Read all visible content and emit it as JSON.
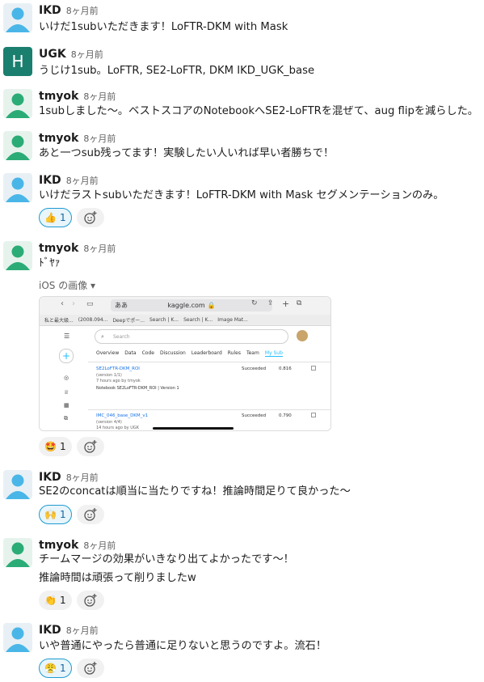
{
  "messages": [
    {
      "author": "IKD",
      "time": "8ヶ月前",
      "lines": [
        "いけだ1subいただきます！LoFTR-DKM with Mask"
      ]
    },
    {
      "author": "UGK",
      "avatar_letter": "H",
      "time": "8ヶ月前",
      "lines": [
        "うじけ1sub。LoFTR, SE2-LoFTR, DKM IKD_UGK_base"
      ]
    },
    {
      "author": "tmyok",
      "time": "8ヶ月前",
      "lines": [
        "1subしました〜。ベストスコアのNotebookへSE2-LoFTRを混ぜて、aug flipを減らした。"
      ]
    },
    {
      "author": "tmyok",
      "time": "8ヶ月前",
      "lines": [
        "あと一つsub残ってます！実験したい人いれば早い者勝ちで！"
      ]
    },
    {
      "author": "IKD",
      "time": "8ヶ月前",
      "lines": [
        "いけだラストsubいただきます！LoFTR-DKM with Mask セグメンテーションのみ。"
      ],
      "reaction": {
        "emoji": "👍",
        "count": "1"
      }
    },
    {
      "author": "tmyok",
      "time": "8ヶ月前",
      "lines": [
        "ﾄﾞﾔｧ"
      ],
      "attachment_label": "iOS の画像 ▾",
      "reaction": {
        "emoji": "🤩",
        "count": "1"
      }
    },
    {
      "author": "IKD",
      "time": "8ヶ月前",
      "lines": [
        "SE2のconcatは順当に当たりですね！推論時間足りて良かった〜"
      ],
      "reaction": {
        "emoji": "🙌",
        "count": "1"
      }
    },
    {
      "author": "tmyok",
      "time": "8ヶ月前",
      "lines": [
        "チームマージの効果がいきなり出てよかったです〜！",
        "推論時間は頑張って削りましたw"
      ],
      "reaction": {
        "emoji": "👏",
        "count": "1"
      }
    },
    {
      "author": "IKD",
      "time": "8ヶ月前",
      "lines": [
        "いや普通にやったら普通に足りないと思うのですよ。流石！"
      ],
      "reaction": {
        "emoji": "😤",
        "count": "1"
      }
    }
  ],
  "screenshot": {
    "url_prefix": "ああ",
    "url": "kaggle.com",
    "bookmarks": [
      "私と最大級...",
      "(2008.094...",
      "Deepでポー...",
      "Search | K...",
      "Search | K...",
      "Image Mat..."
    ],
    "search_placeholder": "Search",
    "tabs": [
      "Overview",
      "Data",
      "Code",
      "Discussion",
      "Leaderboard",
      "Rules",
      "Team",
      "My Sub"
    ],
    "rows": [
      {
        "name": "SE2LoFTR-DKM_ROI",
        "version": "(version 1/1)",
        "ago": "7 hours ago by tmyok",
        "note": "Notebook SE2LoFTR-DKM_ROI | Version 1",
        "status": "Succeeded",
        "score": "0.816"
      },
      {
        "name": "IMC_046_base_DKM_v1",
        "version": "(version 4/4)",
        "ago": "14 hours ago by UGK",
        "note": "",
        "status": "Succeeded",
        "score": "0.790"
      }
    ]
  },
  "colors": {
    "avatar_person": "#2bac76",
    "avatar_person_alt": "#36c5f0",
    "reaction_active": "#1d9bd1",
    "ugk_avatar": "#1a7f6e"
  }
}
